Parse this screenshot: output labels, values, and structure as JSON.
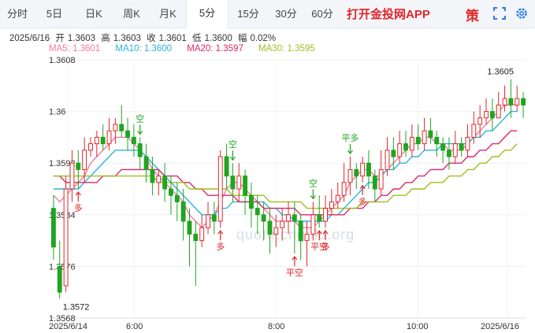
{
  "tabs": [
    {
      "label": "分时",
      "active": false
    },
    {
      "label": "5日",
      "active": false
    },
    {
      "label": "日K",
      "active": false
    },
    {
      "label": "周K",
      "active": false
    },
    {
      "label": "月K",
      "active": false
    },
    {
      "label": "5分",
      "active": true
    },
    {
      "label": "15分",
      "active": false
    },
    {
      "label": "30分",
      "active": false
    },
    {
      "label": "60分",
      "active": false
    }
  ],
  "promo_text": "打开金投网APP",
  "strategy_label": "策",
  "icons": [
    "fullscreen-icon",
    "settings-gear-icon"
  ],
  "info": {
    "date": "2025/6/16",
    "open_label": "开",
    "open": "1.3603",
    "high_label": "高",
    "high": "1.3603",
    "close_label": "收",
    "close": "1.3601",
    "low_label": "低",
    "low": "1.3600",
    "change_label": "幅",
    "change": "0.02%"
  },
  "ma_legend": [
    {
      "label": "MA5: 1.3601",
      "color": "#f07aa6"
    },
    {
      "label": "MA10: 1.3600",
      "color": "#2ab4d8"
    },
    {
      "label": "MA20: 1.3597",
      "color": "#e0266a"
    },
    {
      "label": "MA30: 1.3595",
      "color": "#9fbe1e"
    }
  ],
  "watermark": "quote.cngold.org",
  "colors": {
    "up": "#e0262a",
    "down": "#1fa51f",
    "accent": "#e0262a"
  },
  "chart_data": {
    "type": "candlestick",
    "y_ticks": [
      "1.3608",
      "1.36",
      "1.3592",
      "1.3584",
      "1.3576",
      "1.3568"
    ],
    "ylim": [
      1.3568,
      1.3608
    ],
    "x_ticks": [
      "2025/6/14",
      "6:00",
      "8:00",
      "10:00",
      "2025/6/16"
    ],
    "max_label": "1.3605",
    "min_label": "1.3572",
    "candles": [
      [
        1.3585,
        1.3579,
        1.3587,
        1.3577
      ],
      [
        1.3576,
        1.3572,
        1.358,
        1.3571
      ],
      [
        1.3573,
        1.3588,
        1.359,
        1.3572
      ],
      [
        1.3588,
        1.3592,
        1.3594,
        1.3586
      ],
      [
        1.3592,
        1.3591,
        1.3594,
        1.3588
      ],
      [
        1.3591,
        1.3594,
        1.3596,
        1.3589
      ],
      [
        1.3594,
        1.3595,
        1.3596,
        1.3593
      ],
      [
        1.3595,
        1.3596,
        1.3597,
        1.3593
      ],
      [
        1.3596,
        1.3595,
        1.3598,
        1.3594
      ],
      [
        1.3595,
        1.3597,
        1.3599,
        1.3594
      ],
      [
        1.3597,
        1.3598,
        1.3599,
        1.3595
      ],
      [
        1.3598,
        1.3597,
        1.3601,
        1.3596
      ],
      [
        1.3597,
        1.3596,
        1.3599,
        1.3594
      ],
      [
        1.3596,
        1.3595,
        1.3598,
        1.3593
      ],
      [
        1.3595,
        1.3593,
        1.3596,
        1.3591
      ],
      [
        1.3593,
        1.3591,
        1.3595,
        1.3589
      ],
      [
        1.3591,
        1.3589,
        1.3593,
        1.3587
      ],
      [
        1.3589,
        1.359,
        1.3591,
        1.3587
      ],
      [
        1.359,
        1.3588,
        1.3592,
        1.3586
      ],
      [
        1.3588,
        1.3587,
        1.359,
        1.3584
      ],
      [
        1.3587,
        1.3586,
        1.3589,
        1.3583
      ],
      [
        1.3586,
        1.3583,
        1.3588,
        1.358
      ],
      [
        1.3583,
        1.3581,
        1.3585,
        1.3576
      ],
      [
        1.3581,
        1.358,
        1.3583,
        1.3573
      ],
      [
        1.358,
        1.3582,
        1.3584,
        1.3579
      ],
      [
        1.3582,
        1.3584,
        1.3586,
        1.3581
      ],
      [
        1.3584,
        1.3583,
        1.3586,
        1.3581
      ],
      [
        1.3583,
        1.3593,
        1.3594,
        1.3582
      ],
      [
        1.3593,
        1.359,
        1.3595,
        1.3588
      ],
      [
        1.359,
        1.3588,
        1.3592,
        1.3586
      ],
      [
        1.3588,
        1.359,
        1.3592,
        1.3586
      ],
      [
        1.359,
        1.3587,
        1.3591,
        1.3584
      ],
      [
        1.3587,
        1.3585,
        1.3589,
        1.3582
      ],
      [
        1.3585,
        1.3584,
        1.3587,
        1.3581
      ],
      [
        1.3584,
        1.3583,
        1.3586,
        1.358
      ],
      [
        1.3583,
        1.3581,
        1.3585,
        1.3578
      ],
      [
        1.3581,
        1.3582,
        1.3584,
        1.3579
      ],
      [
        1.3582,
        1.3583,
        1.3585,
        1.358
      ],
      [
        1.3583,
        1.3584,
        1.3586,
        1.3581
      ],
      [
        1.3584,
        1.3583,
        1.3586,
        1.3578
      ],
      [
        1.3583,
        1.358,
        1.3584,
        1.3577
      ],
      [
        1.358,
        1.3581,
        1.3583,
        1.3576
      ],
      [
        1.3581,
        1.3584,
        1.3586,
        1.358
      ],
      [
        1.3584,
        1.3583,
        1.3587,
        1.3582
      ],
      [
        1.3583,
        1.3585,
        1.3587,
        1.3582
      ],
      [
        1.3585,
        1.3586,
        1.3588,
        1.3584
      ],
      [
        1.3586,
        1.3587,
        1.3589,
        1.3585
      ],
      [
        1.3587,
        1.3589,
        1.3592,
        1.3586
      ],
      [
        1.3589,
        1.3591,
        1.3593,
        1.3587
      ],
      [
        1.3591,
        1.359,
        1.3592,
        1.3588
      ],
      [
        1.359,
        1.3592,
        1.3593,
        1.3589
      ],
      [
        1.3592,
        1.359,
        1.3594,
        1.3588
      ],
      [
        1.359,
        1.3588,
        1.3591,
        1.3586
      ],
      [
        1.3588,
        1.3591,
        1.3594,
        1.3587
      ],
      [
        1.3591,
        1.3594,
        1.3596,
        1.359
      ],
      [
        1.3594,
        1.3593,
        1.3596,
        1.3591
      ],
      [
        1.3593,
        1.3595,
        1.3597,
        1.3592
      ],
      [
        1.3595,
        1.3594,
        1.3597,
        1.3593
      ],
      [
        1.3594,
        1.3596,
        1.3598,
        1.3593
      ],
      [
        1.3596,
        1.3595,
        1.3598,
        1.3594
      ],
      [
        1.3595,
        1.3597,
        1.3599,
        1.3594
      ],
      [
        1.3597,
        1.3596,
        1.3599,
        1.3595
      ],
      [
        1.3596,
        1.3595,
        1.3597,
        1.3593
      ],
      [
        1.3595,
        1.3594,
        1.3596,
        1.3592
      ],
      [
        1.3594,
        1.3593,
        1.3596,
        1.3591
      ],
      [
        1.3593,
        1.3595,
        1.3597,
        1.3592
      ],
      [
        1.3595,
        1.3594,
        1.3596,
        1.3593
      ],
      [
        1.3594,
        1.3596,
        1.3598,
        1.3593
      ],
      [
        1.3596,
        1.3598,
        1.36,
        1.3595
      ],
      [
        1.3598,
        1.3599,
        1.3601,
        1.3596
      ],
      [
        1.3599,
        1.36,
        1.3602,
        1.3598
      ],
      [
        1.36,
        1.3599,
        1.3602,
        1.3597
      ],
      [
        1.3599,
        1.3601,
        1.3603,
        1.3599
      ],
      [
        1.3601,
        1.3602,
        1.3604,
        1.36
      ],
      [
        1.3602,
        1.3601,
        1.3605,
        1.3599
      ],
      [
        1.3601,
        1.3602,
        1.3604,
        1.36
      ],
      [
        1.3602,
        1.3601,
        1.3603,
        1.3599
      ]
    ],
    "ma_lines": {
      "MA5": [
        1.3587,
        1.3586,
        1.3587,
        1.3588,
        1.3589,
        1.359,
        1.3592,
        1.3593,
        1.3594,
        1.3595,
        1.3596,
        1.3596,
        1.3596,
        1.3595,
        1.3594,
        1.3593,
        1.3591,
        1.359,
        1.3589,
        1.3588,
        1.3587,
        1.3586,
        1.3584,
        1.3583,
        1.3582,
        1.3583,
        1.3584,
        1.3586,
        1.3588,
        1.3589,
        1.3589,
        1.3588,
        1.3587,
        1.3586,
        1.3585,
        1.3584,
        1.3583,
        1.3583,
        1.3583,
        1.3583,
        1.3582,
        1.3582,
        1.3582,
        1.3583,
        1.3584,
        1.3585,
        1.3586,
        1.3587,
        1.3589,
        1.359,
        1.3591,
        1.3591,
        1.359,
        1.359,
        1.3591,
        1.3592,
        1.3593,
        1.3594,
        1.3595,
        1.3595,
        1.3596,
        1.3596,
        1.3595,
        1.3595,
        1.3594,
        1.3594,
        1.3594,
        1.3595,
        1.3596,
        1.3597,
        1.3598,
        1.3599,
        1.36,
        1.3601,
        1.3601,
        1.3601
      ],
      "MA10": [
        1.3588,
        1.3588,
        1.3588,
        1.3588,
        1.3588,
        1.3589,
        1.359,
        1.3591,
        1.3592,
        1.3593,
        1.3594,
        1.3594,
        1.3594,
        1.3594,
        1.3594,
        1.3593,
        1.3592,
        1.3591,
        1.359,
        1.3589,
        1.3588,
        1.3587,
        1.3586,
        1.3585,
        1.3584,
        1.3584,
        1.3584,
        1.3585,
        1.3585,
        1.3586,
        1.3586,
        1.3586,
        1.3586,
        1.3586,
        1.3586,
        1.3585,
        1.3585,
        1.3584,
        1.3584,
        1.3583,
        1.3583,
        1.3583,
        1.3583,
        1.3583,
        1.3583,
        1.3584,
        1.3584,
        1.3585,
        1.3586,
        1.3587,
        1.3588,
        1.3589,
        1.3589,
        1.359,
        1.3591,
        1.3591,
        1.3592,
        1.3592,
        1.3593,
        1.3593,
        1.3594,
        1.3594,
        1.3594,
        1.3595,
        1.3595,
        1.3595,
        1.3595,
        1.3595,
        1.3596,
        1.3596,
        1.3597,
        1.3597,
        1.3598,
        1.3599,
        1.36,
        1.36
      ],
      "MA20": [
        1.359,
        1.359,
        1.3589,
        1.3589,
        1.3589,
        1.3589,
        1.3589,
        1.3589,
        1.359,
        1.359,
        1.359,
        1.3591,
        1.3591,
        1.3591,
        1.3591,
        1.3591,
        1.3591,
        1.3591,
        1.359,
        1.359,
        1.359,
        1.3589,
        1.3589,
        1.3588,
        1.3588,
        1.3587,
        1.3587,
        1.3587,
        1.3587,
        1.3587,
        1.3586,
        1.3586,
        1.3586,
        1.3586,
        1.3585,
        1.3585,
        1.3585,
        1.3585,
        1.3585,
        1.3585,
        1.3584,
        1.3584,
        1.3584,
        1.3584,
        1.3584,
        1.3584,
        1.3584,
        1.3584,
        1.3585,
        1.3585,
        1.3585,
        1.3586,
        1.3586,
        1.3587,
        1.3587,
        1.3588,
        1.3588,
        1.3589,
        1.3589,
        1.359,
        1.359,
        1.3591,
        1.3591,
        1.3591,
        1.3592,
        1.3592,
        1.3592,
        1.3593,
        1.3593,
        1.3594,
        1.3594,
        1.3595,
        1.3595,
        1.3596,
        1.3597,
        1.3597
      ],
      "MA30": [
        1.359,
        1.359,
        1.359,
        1.359,
        1.359,
        1.359,
        1.359,
        1.359,
        1.359,
        1.359,
        1.359,
        1.359,
        1.359,
        1.359,
        1.359,
        1.359,
        1.359,
        1.3589,
        1.3589,
        1.3589,
        1.3589,
        1.3589,
        1.3588,
        1.3588,
        1.3588,
        1.3588,
        1.3588,
        1.3588,
        1.3588,
        1.3587,
        1.3587,
        1.3587,
        1.3587,
        1.3587,
        1.3587,
        1.3586,
        1.3586,
        1.3586,
        1.3586,
        1.3586,
        1.3586,
        1.3585,
        1.3585,
        1.3585,
        1.3585,
        1.3585,
        1.3585,
        1.3585,
        1.3585,
        1.3585,
        1.3586,
        1.3586,
        1.3586,
        1.3586,
        1.3586,
        1.3587,
        1.3587,
        1.3587,
        1.3588,
        1.3588,
        1.3588,
        1.3589,
        1.3589,
        1.3589,
        1.359,
        1.359,
        1.359,
        1.3591,
        1.3591,
        1.3592,
        1.3592,
        1.3593,
        1.3593,
        1.3594,
        1.3594,
        1.3595
      ]
    },
    "signals": [
      {
        "label": "多",
        "type": "buy",
        "index": 4
      },
      {
        "label": "空",
        "type": "sell",
        "index": 14
      },
      {
        "label": "多",
        "type": "buy",
        "index": 27
      },
      {
        "label": "空",
        "type": "sell",
        "index": 29
      },
      {
        "label": "平空",
        "type": "buy",
        "index": 39
      },
      {
        "label": "空",
        "type": "sell",
        "index": 42
      },
      {
        "label": "平空",
        "type": "buy",
        "index": 43
      },
      {
        "label": "多",
        "type": "buy",
        "index": 44
      },
      {
        "label": "平多",
        "type": "sell",
        "index": 48
      },
      {
        "label": "多",
        "type": "buy",
        "index": 50
      }
    ]
  }
}
